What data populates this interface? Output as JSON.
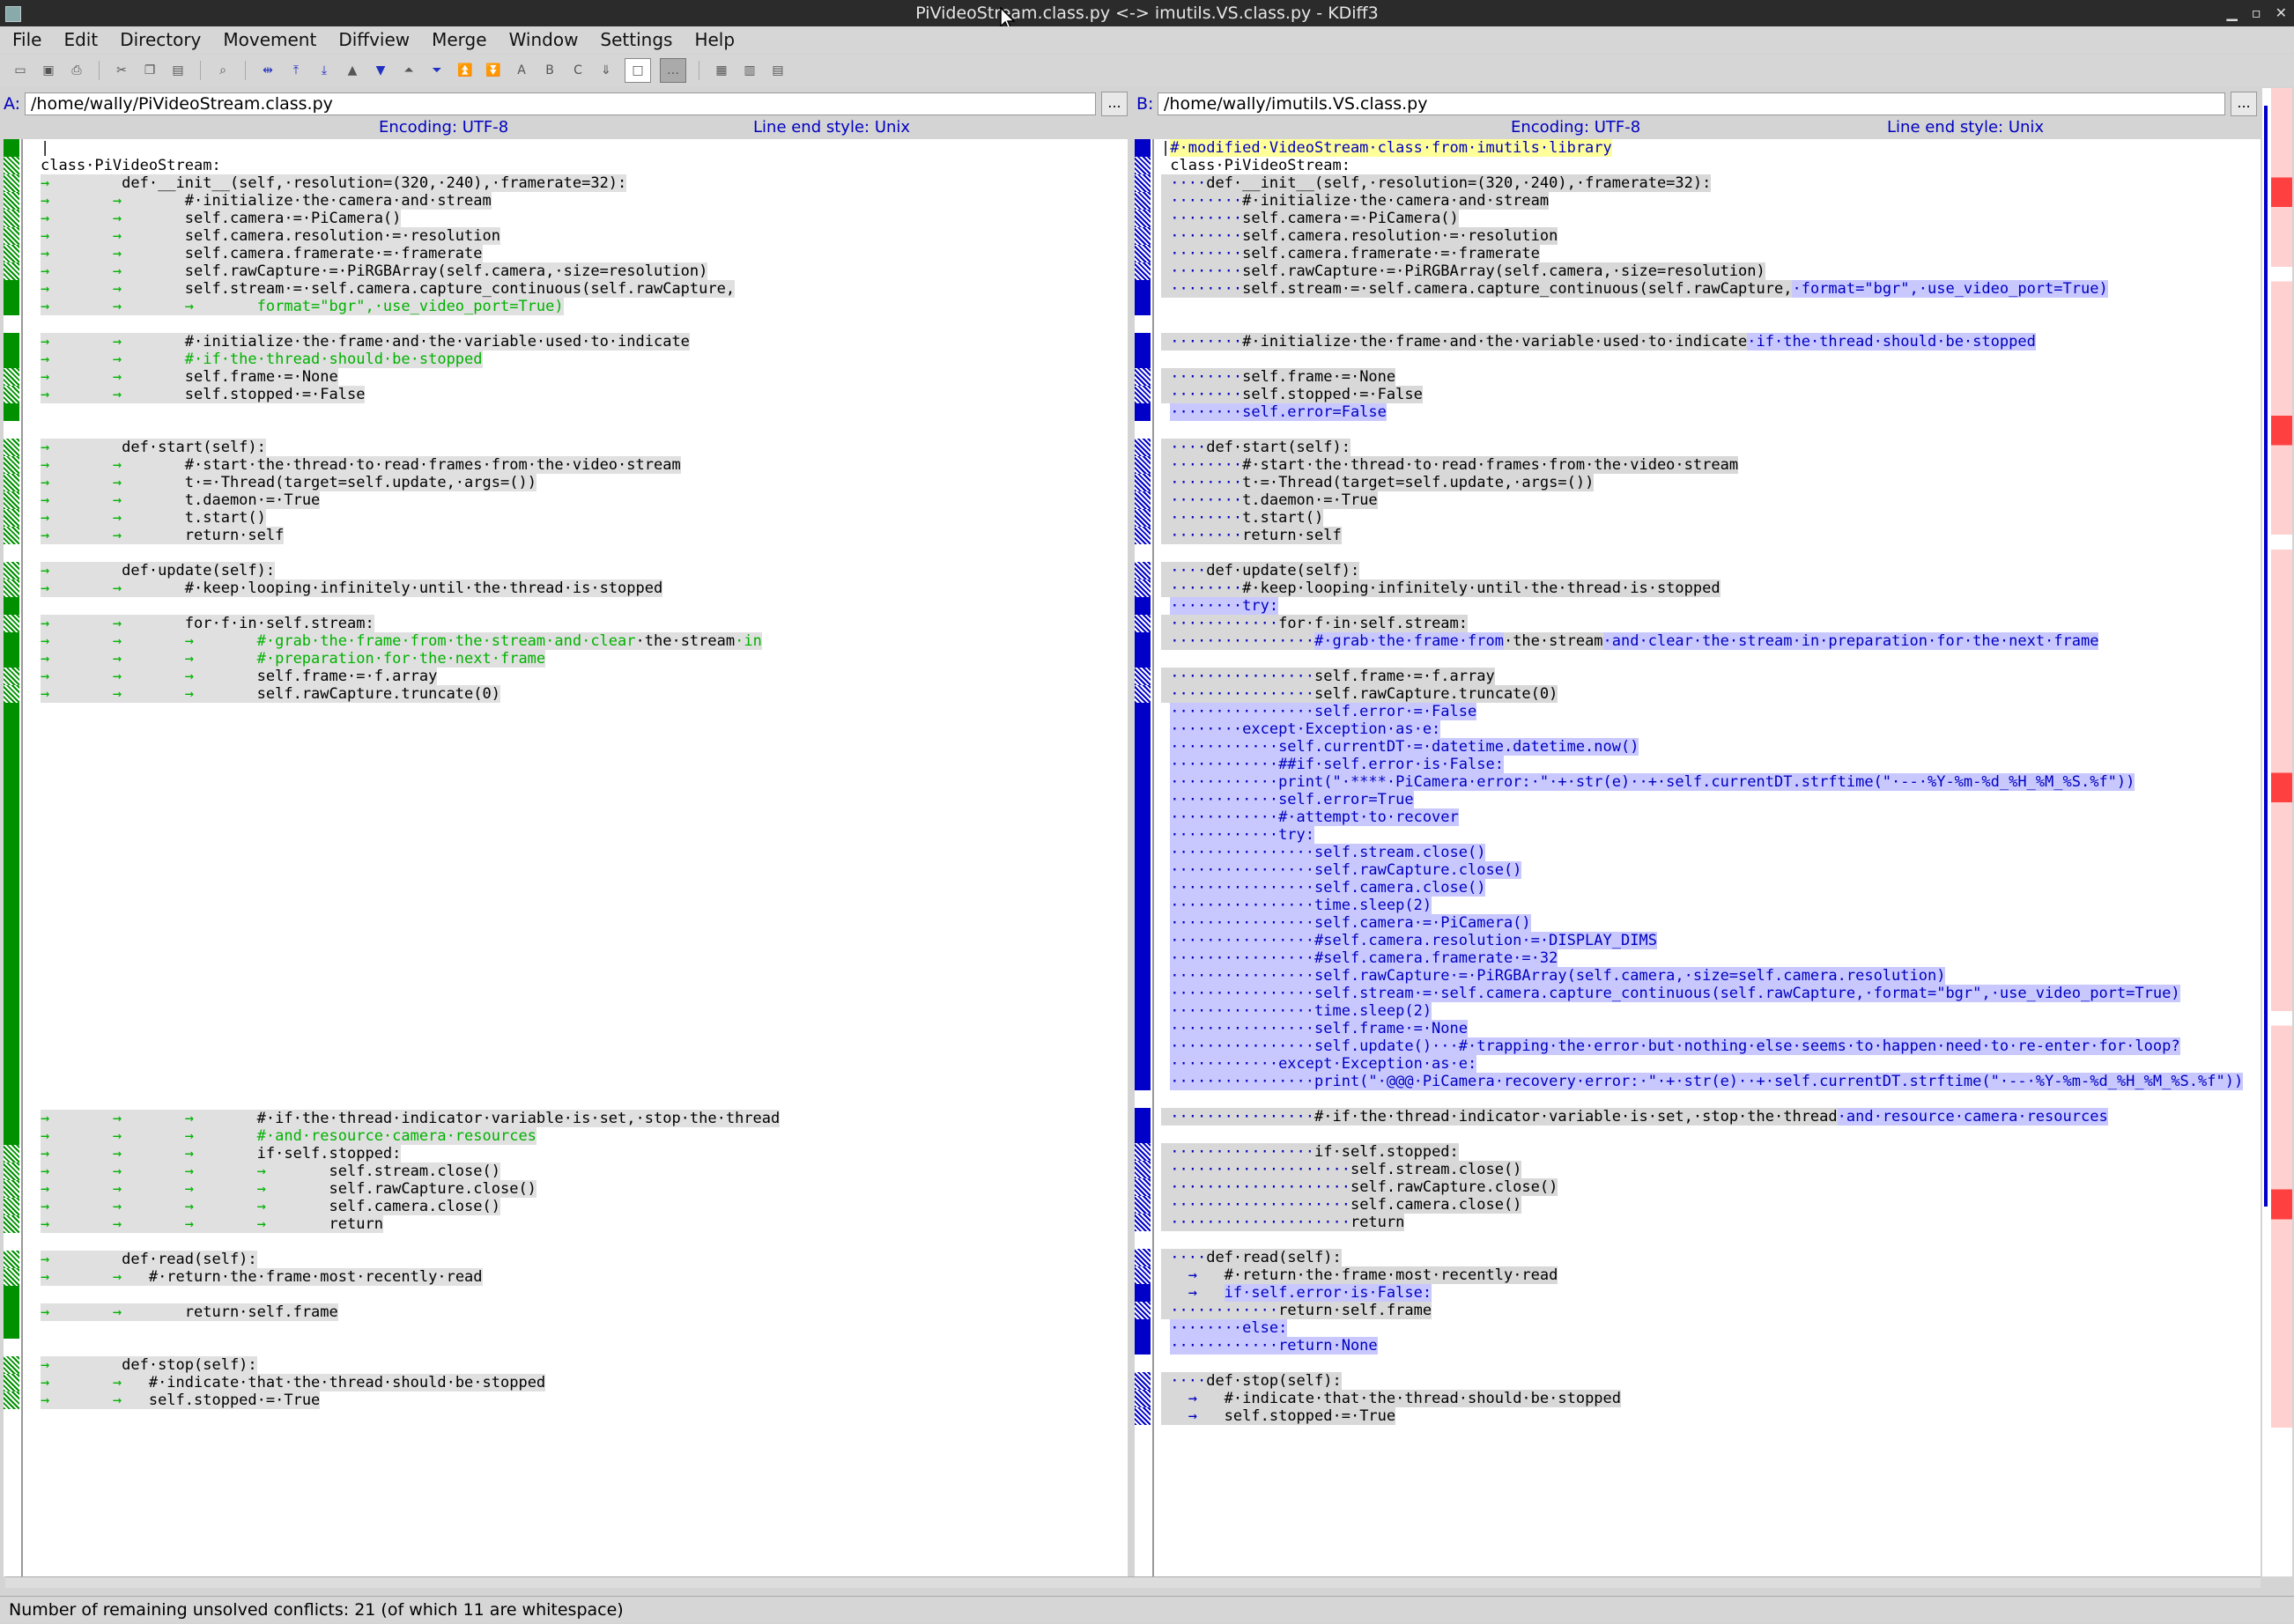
{
  "window": {
    "title": "PiVideoStream.class.py <-> imutils.VS.class.py - KDiff3"
  },
  "menu": [
    "File",
    "Edit",
    "Directory",
    "Movement",
    "Diffview",
    "Merge",
    "Window",
    "Settings",
    "Help"
  ],
  "toolbar": {
    "icons": [
      "new-icon",
      "save-icon",
      "print-icon",
      "cut-icon",
      "copy-icon",
      "paste-icon",
      "find-icon",
      "go-current-icon",
      "go-top-icon",
      "go-bottom-icon",
      "go-prev-delta-icon",
      "go-next-delta-icon",
      "go-prev-conflict-icon",
      "go-next-conflict-icon",
      "go-prev-unsolved-icon",
      "go-next-unsolved-icon",
      "select-a-icon",
      "select-b-icon",
      "select-c-icon",
      "auto-advance-icon",
      "show-whitespace-icon",
      "show-linenumbers-icon",
      "split-horizontal-icon",
      "split-vertical-icon",
      "split-wordwrap-icon"
    ],
    "letter_a": "A",
    "letter_b": "B",
    "letter_c": "C"
  },
  "pane_a": {
    "label": "A:",
    "path": "/home/wally/PiVideoStream.class.py",
    "browse": "...",
    "encoding": "Encoding: UTF-8",
    "line_end": "Line end style: Unix"
  },
  "pane_b": {
    "label": "B:",
    "path": "/home/wally/imutils.VS.class.py",
    "browse": "...",
    "encoding": "Encoding: UTF-8",
    "line_end": "Line end style: Unix"
  },
  "status": {
    "text": "Number of remaining unsolved conflicts: 21 (of which 11 are whitespace)"
  },
  "colors": {
    "a_marker": "#009000",
    "b_marker": "#0000c8",
    "diff_text_a": "#00b200",
    "diff_text_b": "#0000c0"
  }
}
